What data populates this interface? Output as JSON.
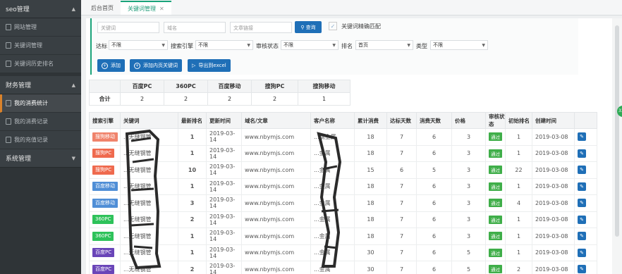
{
  "sidebar": {
    "groups": [
      {
        "title": "seo管理",
        "items": [
          "网站管理",
          "关键词管理",
          "关键词历史排名"
        ]
      },
      {
        "title": "财务管理",
        "items": [
          "我的消费统计",
          "我的消费记录",
          "我的充值记录"
        ]
      },
      {
        "title": "系统管理",
        "items": []
      }
    ],
    "active_item": "我的消费统计"
  },
  "tabs": [
    {
      "label": "后台首页"
    },
    {
      "label": "关键词管理"
    }
  ],
  "filters": {
    "keyword_placeholder": "关键词",
    "domain_placeholder": "域名",
    "article_placeholder": "文章链接",
    "query_label": "查询",
    "exact_match_label": "关键词精确匹配",
    "selects": [
      {
        "label": "达标",
        "value": "不限"
      },
      {
        "label": "搜索引擎",
        "value": "不限"
      },
      {
        "label": "审核状态",
        "value": "不限"
      },
      {
        "label": "排名",
        "value": "首页"
      },
      {
        "label": "类型",
        "value": "不限"
      }
    ]
  },
  "actions": {
    "add_label": "添加",
    "add_inner_label": "添加内页关键词",
    "export_label": "导出到excel"
  },
  "summary": {
    "headers": [
      "",
      "百度PC",
      "360PC",
      "百度移动",
      "搜狗PC",
      "搜狗移动"
    ],
    "row": [
      "合计",
      "2",
      "2",
      "2",
      "2",
      "1"
    ]
  },
  "table": {
    "headers": [
      "搜索引擎",
      "关键词",
      "最新排名",
      "更新时间",
      "域名/文章",
      "客户名称",
      "累计消费",
      "达标天数",
      "消费天数",
      "价格",
      "审核状态",
      "初始排名",
      "创建时间",
      ""
    ],
    "rows": [
      {
        "engine": "搜狗移动",
        "engine_color": "#f0836b",
        "keyword": "...无缝钢管",
        "rank": "1",
        "updated": "2019-03-14",
        "domain": "www.nbymjs.com",
        "client": "...钢金属",
        "total": "18",
        "reach_days": "7",
        "consume_days": "6",
        "price": "3",
        "status": "通过",
        "init_rank": "1",
        "created": "2019-03-08"
      },
      {
        "engine": "搜狗PC",
        "engine_color": "#ef6a4e",
        "keyword": "...无缝钢管",
        "rank": "1",
        "updated": "2019-03-14",
        "domain": "www.nbymjs.com",
        "client": "...金属",
        "total": "18",
        "reach_days": "7",
        "consume_days": "6",
        "price": "3",
        "status": "通过",
        "init_rank": "1",
        "created": "2019-03-08"
      },
      {
        "engine": "搜狗PC",
        "engine_color": "#ef6a4e",
        "keyword": "...无缝钢管",
        "rank": "10",
        "updated": "2019-03-14",
        "domain": "www.nbymjs.com",
        "client": "...金属",
        "total": "15",
        "reach_days": "6",
        "consume_days": "5",
        "price": "3",
        "status": "通过",
        "init_rank": "22",
        "created": "2019-03-08"
      },
      {
        "engine": "百度移动",
        "engine_color": "#4f8ed6",
        "keyword": "...无缝钢管",
        "rank": "1",
        "updated": "2019-03-14",
        "domain": "www.nbymjs.com",
        "client": "...金属",
        "total": "18",
        "reach_days": "7",
        "consume_days": "6",
        "price": "3",
        "status": "通过",
        "init_rank": "1",
        "created": "2019-03-08"
      },
      {
        "engine": "百度移动",
        "engine_color": "#4f8ed6",
        "keyword": "...无缝钢管",
        "rank": "3",
        "updated": "2019-03-14",
        "domain": "www.nbymjs.com",
        "client": "...金属",
        "total": "18",
        "reach_days": "7",
        "consume_days": "6",
        "price": "3",
        "status": "通过",
        "init_rank": "4",
        "created": "2019-03-08"
      },
      {
        "engine": "360PC",
        "engine_color": "#2ec25a",
        "keyword": "...无缝钢管",
        "rank": "2",
        "updated": "2019-03-14",
        "domain": "www.nbymjs.com",
        "client": "...金属",
        "total": "18",
        "reach_days": "7",
        "consume_days": "6",
        "price": "3",
        "status": "通过",
        "init_rank": "1",
        "created": "2019-03-08"
      },
      {
        "engine": "360PC",
        "engine_color": "#2ec25a",
        "keyword": "...无缝钢管",
        "rank": "1",
        "updated": "2019-03-14",
        "domain": "www.nbymjs.com",
        "client": "...金属",
        "total": "18",
        "reach_days": "7",
        "consume_days": "6",
        "price": "3",
        "status": "通过",
        "init_rank": "1",
        "created": "2019-03-08"
      },
      {
        "engine": "百度PC",
        "engine_color": "#6a45b8",
        "keyword": "...无缝钢管",
        "rank": "1",
        "updated": "2019-03-14",
        "domain": "www.nbymjs.com",
        "client": "...金属",
        "total": "30",
        "reach_days": "7",
        "consume_days": "6",
        "price": "5",
        "status": "通过",
        "init_rank": "1",
        "created": "2019-03-08"
      },
      {
        "engine": "百度PC",
        "engine_color": "#6a45b8",
        "keyword": "...无缝钢管",
        "rank": "2",
        "updated": "2019-03-14",
        "domain": "www.nbymjs.com",
        "client": "...金属",
        "total": "30",
        "reach_days": "7",
        "consume_days": "6",
        "price": "5",
        "status": "通过",
        "init_rank": "2",
        "created": "2019-03-08"
      }
    ]
  },
  "colors": {
    "accent": "#1aa37a",
    "primary": "#1f6fb7",
    "rank_red": "#d9534f",
    "pass_green": "#3fae49"
  }
}
